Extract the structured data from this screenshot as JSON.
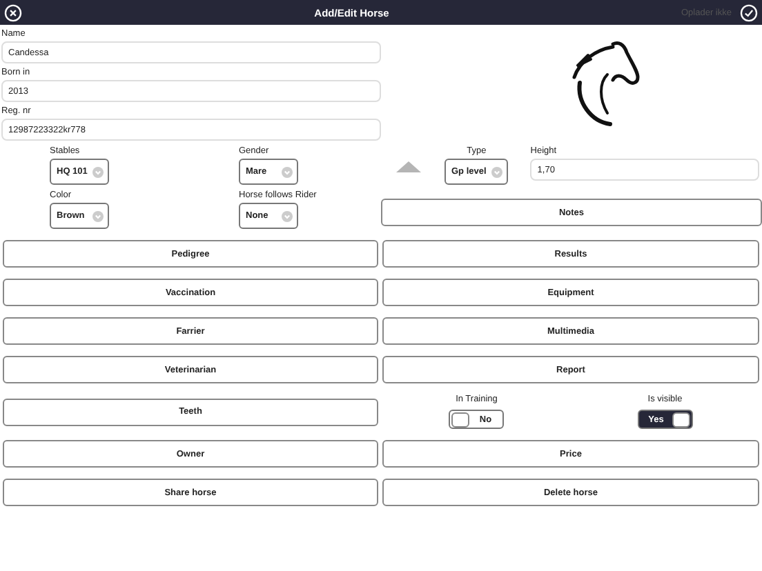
{
  "header": {
    "title": "Add/Edit Horse",
    "status_text": "Oplader ikke"
  },
  "fields": [
    {
      "label": "Name",
      "value": "Candessa"
    },
    {
      "label": "Born in",
      "value": "2013"
    },
    {
      "label": "Reg. nr",
      "value": "12987223322kr778"
    }
  ],
  "selects": [
    {
      "label": "Stables",
      "value": "HQ 101"
    },
    {
      "label": "Gender",
      "value": "Mare"
    },
    {
      "label": "Color",
      "value": "Brown"
    },
    {
      "label": "Horse follows Rider",
      "value": "None"
    }
  ],
  "type_select": {
    "label": "Type",
    "value": "Gp level"
  },
  "height_field": {
    "label": "Height",
    "value": "1,70"
  },
  "notes_button": "Notes",
  "rows": [
    {
      "kind": "buttons",
      "left": "Pedigree",
      "right": "Results"
    },
    {
      "kind": "buttons",
      "left": "Vaccination",
      "right": "Equipment"
    },
    {
      "kind": "buttons",
      "left": "Farrier",
      "right": "Multimedia"
    },
    {
      "kind": "buttons",
      "left": "Veterinarian",
      "right": "Report"
    },
    {
      "kind": "toggles",
      "left": "Teeth",
      "toggles": [
        {
          "label": "In Training",
          "value": "No",
          "on": false
        },
        {
          "label": "Is visible",
          "value": "Yes",
          "on": true
        }
      ]
    },
    {
      "kind": "buttons",
      "left": "Owner",
      "right": "Price"
    },
    {
      "kind": "buttons",
      "left": "Share horse",
      "right": "Delete horse"
    }
  ]
}
